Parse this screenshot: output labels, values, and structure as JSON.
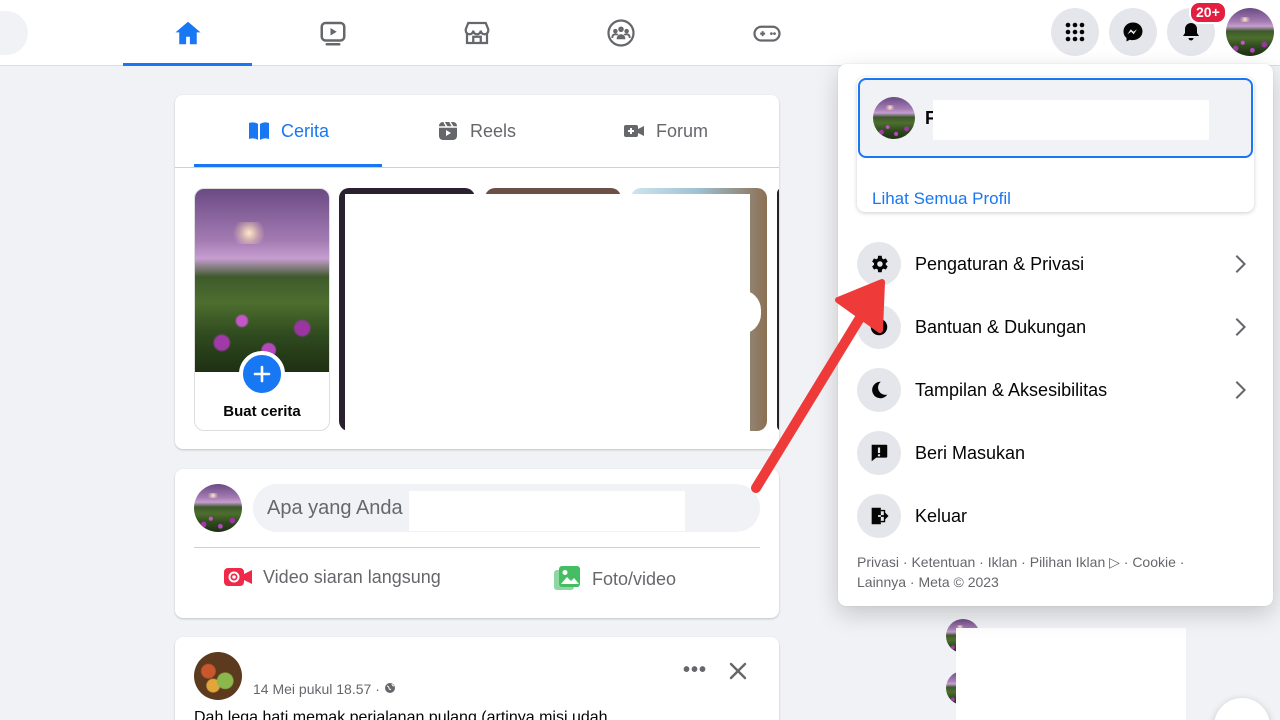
{
  "topbar": {
    "notification_badge": "20+"
  },
  "stories": {
    "tabs": [
      {
        "label": "Cerita",
        "icon": "book-open-icon"
      },
      {
        "label": "Reels",
        "icon": "reels-icon"
      },
      {
        "label": "Forum",
        "icon": "video-camera-plus-icon"
      }
    ],
    "create_label": "Buat cerita"
  },
  "composer": {
    "placeholder": "Apa yang Anda",
    "actions": [
      {
        "label": "Video siaran langsung",
        "icon": "live-video-icon",
        "color": "#f02849"
      },
      {
        "label": "Foto/video",
        "icon": "photo-icon",
        "color": "#45bd62"
      }
    ]
  },
  "post": {
    "meta": "14 Mei pukul 18.57 · ",
    "text": "Dah lega hati memak perjalanan pulang (artinya misi udah"
  },
  "menu": {
    "profile_initial": "F",
    "see_all": "Lihat Semua Profil",
    "items": [
      {
        "label": "Pengaturan & Privasi",
        "icon": "gear-icon",
        "chevron": true
      },
      {
        "label": "Bantuan & Dukungan",
        "icon": "help-icon",
        "chevron": true
      },
      {
        "label": "Tampilan & Aksesibilitas",
        "icon": "moon-icon",
        "chevron": true
      },
      {
        "label": "Beri Masukan",
        "icon": "feedback-icon",
        "chevron": false
      },
      {
        "label": "Keluar",
        "icon": "logout-icon",
        "chevron": false
      }
    ],
    "footer_line1": "Privasi · Ketentuan · Iklan · Pilihan Iklan ▷ · Cookie ·",
    "footer_line2": "Lainnya · Meta © 2023"
  },
  "colors": {
    "accent": "#1877f2",
    "annotation_arrow": "#ef3a3a"
  }
}
